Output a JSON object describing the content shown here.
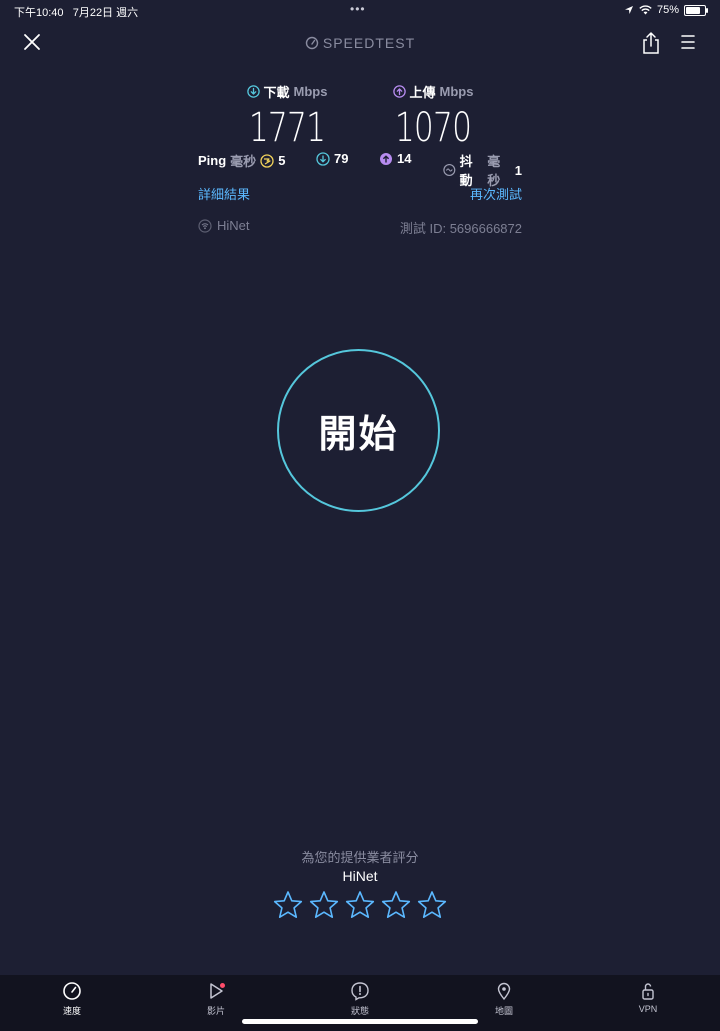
{
  "status_bar": {
    "time": "下午10:40",
    "date": "7月22日 週六",
    "dots": "•••",
    "battery_pct": "75%",
    "battery_level": 0.75
  },
  "header": {
    "brand": "SPEEDTEST"
  },
  "download": {
    "label": "下載",
    "unit": "Mbps",
    "value": "1771"
  },
  "upload": {
    "label": "上傳",
    "unit": "Mbps",
    "value": "1070"
  },
  "ping": {
    "label": "Ping",
    "unit": "毫秒",
    "idle": "5",
    "down": "79",
    "up": "14"
  },
  "jitter": {
    "label": "抖動",
    "unit": "毫秒",
    "value": "1"
  },
  "links": {
    "details": "詳細結果",
    "retest": "再次測試"
  },
  "provider": {
    "name": "HiNet",
    "test_id": "測試 ID: 5696666872"
  },
  "go_button": {
    "label": "開始"
  },
  "rating": {
    "title": "為您的提供業者評分",
    "isp": "HiNet",
    "stars": 5
  },
  "tabs": [
    {
      "label": "速度"
    },
    {
      "label": "影片"
    },
    {
      "label": "狀態"
    },
    {
      "label": "地圖"
    },
    {
      "label": "VPN"
    }
  ],
  "colors": {
    "background": "#1d1f33",
    "accent": "#55c7dc",
    "download": "#55c7dc",
    "upload": "#b78cf0",
    "link": "#5bb8ff",
    "ping_idle": "#f2d35b"
  }
}
